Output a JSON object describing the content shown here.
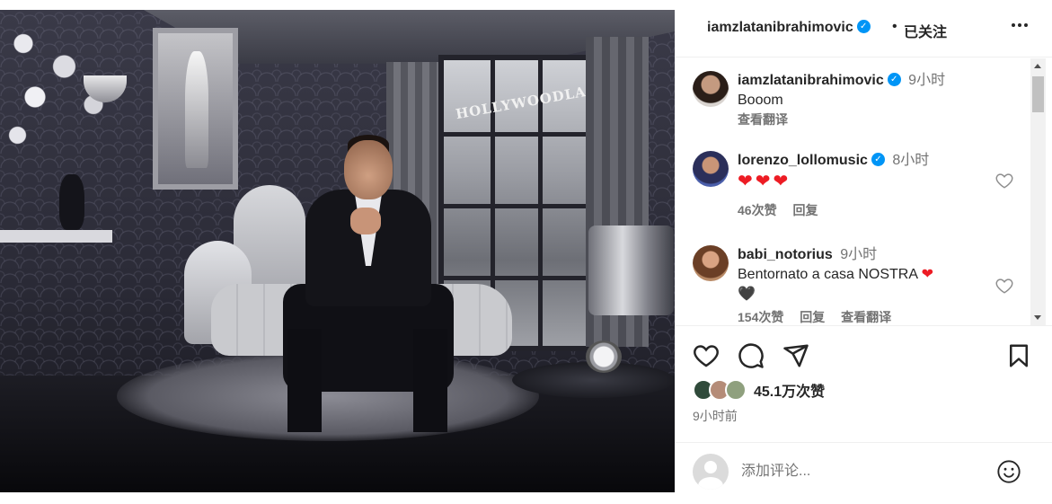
{
  "post": {
    "image_alt": "Man in tuxedo seated on a grey chaise lounge in a dark room with a window view of the HOLLYWOODLAND sign",
    "sign_text": "HOLLYWOODLAND"
  },
  "header": {
    "username": "iamzlatanibrahimovic",
    "separator": "•",
    "follow_state": "已关注"
  },
  "comments": [
    {
      "username": "iamzlatanibrahimovic",
      "verified": true,
      "time": "9小时",
      "text": "Booom",
      "translate": "查看翻译"
    },
    {
      "username": "lorenzo_lollomusic",
      "verified": true,
      "time": "8小时",
      "text": "❤❤❤",
      "likes": "46次赞",
      "reply": "回复"
    },
    {
      "username": "babi_notorius",
      "verified": false,
      "time": "9小时",
      "text": "Bentornato a casa NOSTRA",
      "text_emoji_1": "❤",
      "text_emoji_2": "🖤",
      "likes": "154次赞",
      "reply": "回复",
      "translate": "查看翻译"
    }
  ],
  "actions": {
    "likes_count": "45.1万次赞",
    "posted_time": "9小时前"
  },
  "add_comment": {
    "placeholder": "添加评论..."
  },
  "colors": {
    "verified": "#0095f6",
    "heart": "#ed1c24",
    "text_primary": "#262626",
    "text_secondary": "#737373"
  }
}
